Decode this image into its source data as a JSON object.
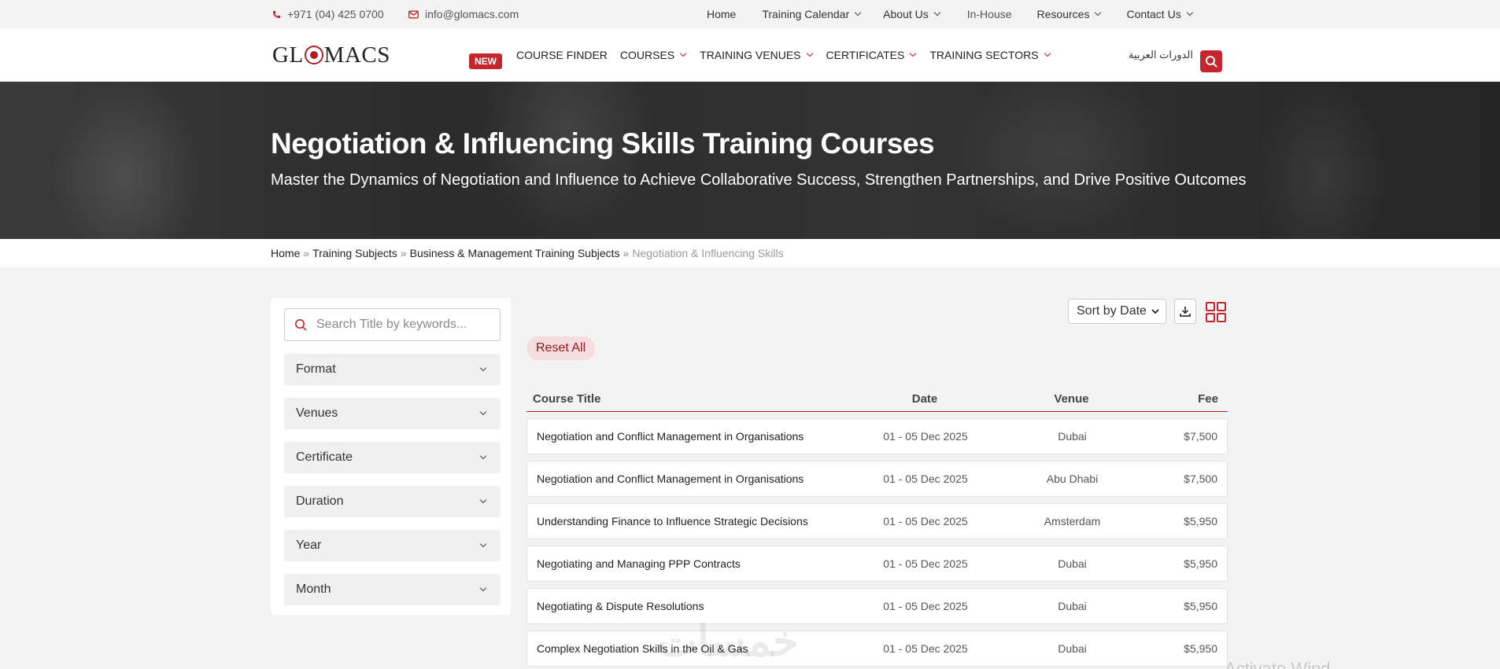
{
  "topbar": {
    "phone": "+971 (04) 425 0700",
    "email": "info@glomacs.com",
    "nav": [
      {
        "label": "Home",
        "dropdown": false
      },
      {
        "label": "Training Calendar",
        "dropdown": true
      },
      {
        "label": "About Us",
        "dropdown": true
      },
      {
        "label": "In-House",
        "dropdown": false
      },
      {
        "label": "Resources",
        "dropdown": true
      },
      {
        "label": "Contact Us",
        "dropdown": true
      }
    ]
  },
  "header": {
    "logo_text_left": "GL",
    "logo_text_right": "MACS",
    "new_badge": "NEW",
    "nav": [
      {
        "label": "COURSE FINDER",
        "dropdown": false
      },
      {
        "label": "COURSES",
        "dropdown": true
      },
      {
        "label": "TRAINING VENUES",
        "dropdown": true
      },
      {
        "label": "CERTIFICATES",
        "dropdown": true
      },
      {
        "label": "TRAINING SECTORS",
        "dropdown": true
      }
    ],
    "arabic_link": "الدورات العربية",
    "search_icon": "search-icon"
  },
  "hero": {
    "title": "Negotiation & Influencing Skills Training Courses",
    "subtitle": "Master the Dynamics of Negotiation and Influence to Achieve Collaborative Success, Strengthen Partnerships, and Drive Positive Outcomes"
  },
  "breadcrumb": {
    "items": [
      "Home",
      "Training Subjects",
      "Business & Management Training Subjects"
    ],
    "separator": "»",
    "current": "Negotiation & Influencing Skills"
  },
  "sidebar": {
    "search_placeholder": "Search Title by keywords...",
    "filters": [
      "Format",
      "Venues",
      "Certificate",
      "Duration",
      "Year",
      "Month"
    ]
  },
  "controls": {
    "sort_label": "Sort by Date",
    "reset_label": "Reset All"
  },
  "table": {
    "headers": {
      "title": "Course Title",
      "date": "Date",
      "venue": "Venue",
      "fee": "Fee"
    },
    "rows": [
      {
        "title": "Negotiation and Conflict Management in Organisations",
        "date": "01 - 05 Dec 2025",
        "venue": "Dubai",
        "fee": "$7,500"
      },
      {
        "title": "Negotiation and Conflict Management in Organisations",
        "date": "01 - 05 Dec 2025",
        "venue": "Abu Dhabi",
        "fee": "$7,500"
      },
      {
        "title": "Understanding Finance to Influence Strategic Decisions",
        "date": "01 - 05 Dec 2025",
        "venue": "Amsterdam",
        "fee": "$5,950"
      },
      {
        "title": "Negotiating and Managing PPP Contracts",
        "date": "01 - 05 Dec 2025",
        "venue": "Dubai",
        "fee": "$5,950"
      },
      {
        "title": "Negotiating & Dispute Resolutions",
        "date": "01 - 05 Dec 2025",
        "venue": "Dubai",
        "fee": "$5,950"
      },
      {
        "title": "Complex Negotiation Skills in the Oil & Gas",
        "date": "01 - 05 Dec 2025",
        "venue": "Dubai",
        "fee": "$5,950"
      }
    ]
  },
  "overlay": {
    "watermark": "خمسات",
    "activate_text": "Activate Wind"
  },
  "colors": {
    "brand_red": "#c4262c",
    "hero_dark": "#2b2b2b",
    "page_bg": "#f3f3f3"
  }
}
